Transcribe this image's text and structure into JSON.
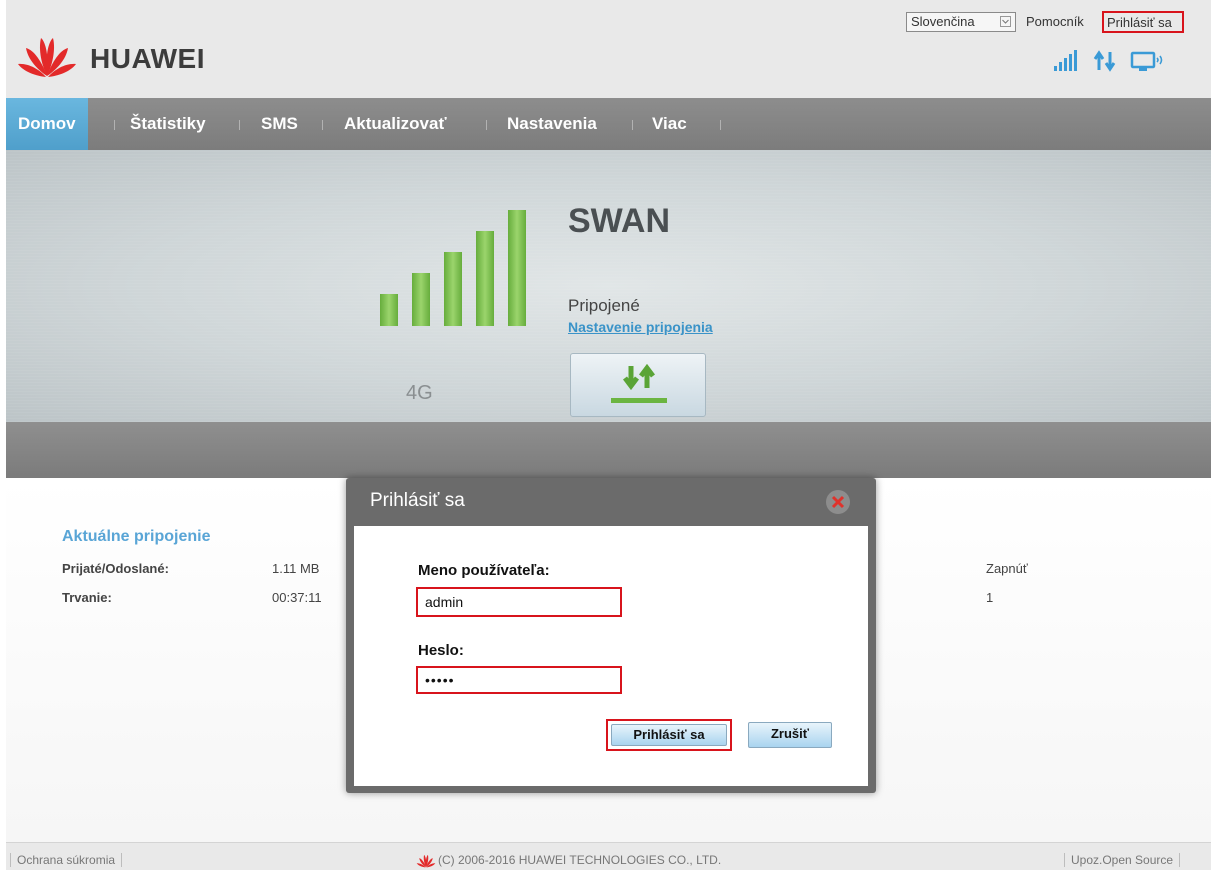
{
  "header": {
    "brand": "HUAWEI",
    "language": "Slovenčina",
    "help": "Pomocník",
    "login_link": "Prihlásiť sa"
  },
  "nav": {
    "items": [
      {
        "label": "Domov",
        "active": true
      },
      {
        "label": "Štatistiky"
      },
      {
        "label": "SMS"
      },
      {
        "label": "Aktualizovať"
      },
      {
        "label": "Nastavenia"
      },
      {
        "label": "Viac"
      }
    ]
  },
  "status": {
    "network_type": "4G",
    "isp": "SWAN",
    "connection_status": "Pripojené",
    "connection_settings": "Nastavenie pripojenia",
    "signal_level": 5,
    "signal_max": 5
  },
  "current_connection": {
    "title": "Aktuálne pripojenie",
    "rows": [
      {
        "label": "Prijaté/Odoslané:",
        "value": "1.11 MB",
        "right_value": "Zapnúť"
      },
      {
        "label": "Trvanie:",
        "value": "00:37:11",
        "right_value": "1"
      }
    ]
  },
  "login_dialog": {
    "title": "Prihlásiť sa",
    "username_label": "Meno používateľa:",
    "username_value": "admin",
    "password_label": "Heslo:",
    "password_value": "•••••",
    "login_button": "Prihlásiť sa",
    "cancel_button": "Zrušiť"
  },
  "footer": {
    "privacy": "Ochrana súkromia",
    "copyright": "(C) 2006-2016 HUAWEI TECHNOLOGIES CO., LTD.",
    "open_source": "Upoz.Open Source"
  },
  "colors": {
    "accent_blue": "#59a5d6",
    "nav_active": "#5aa9d6",
    "huawei_red": "#d8141c",
    "signal_green": "#7fbf4d",
    "highlight_red": "#d8141c"
  }
}
